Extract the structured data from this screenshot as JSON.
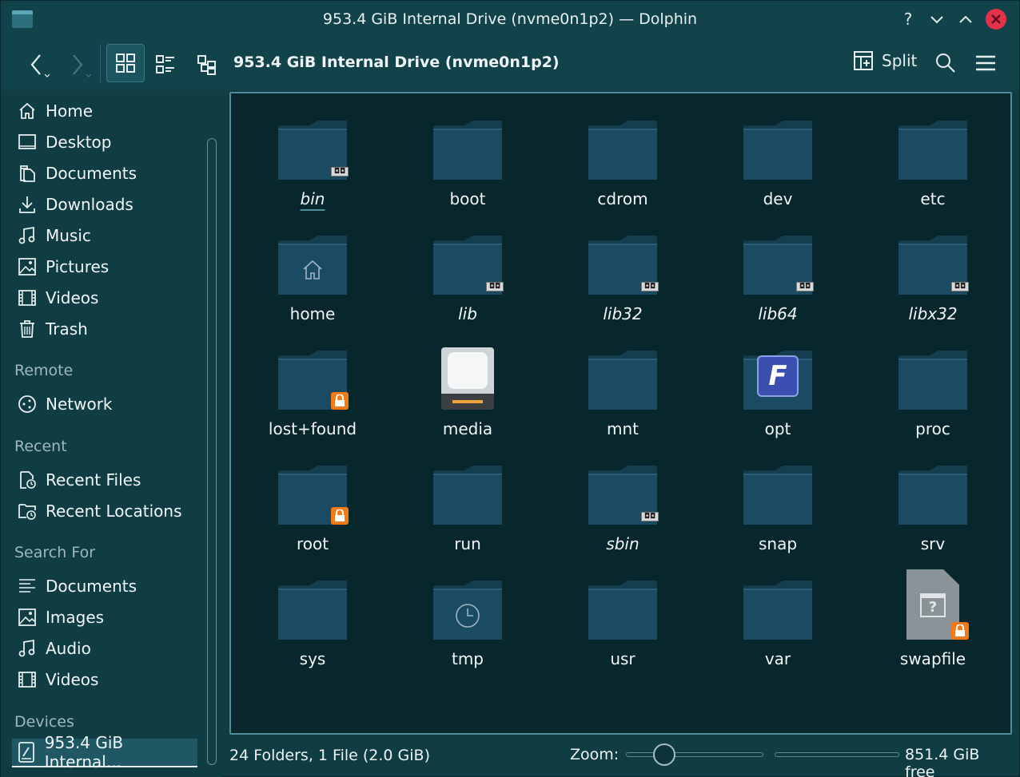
{
  "window": {
    "title": "953.4 GiB Internal Drive (nvme0n1p2) — Dolphin",
    "help": "?",
    "minimize": "⌄",
    "maximize": "⌃",
    "close": "✕"
  },
  "toolbar": {
    "back_icon": "chevron-left-icon",
    "forward_icon": "chevron-right-icon",
    "location": "953.4 GiB Internal Drive (nvme0n1p2)",
    "split_label": "Split"
  },
  "sidebar": {
    "places": [
      {
        "label": "Home",
        "icon": "home-icon"
      },
      {
        "label": "Desktop",
        "icon": "desktop-icon"
      },
      {
        "label": "Documents",
        "icon": "documents-icon"
      },
      {
        "label": "Downloads",
        "icon": "downloads-icon"
      },
      {
        "label": "Music",
        "icon": "music-icon"
      },
      {
        "label": "Pictures",
        "icon": "pictures-icon"
      },
      {
        "label": "Videos",
        "icon": "videos-icon"
      },
      {
        "label": "Trash",
        "icon": "trash-icon"
      }
    ],
    "remote_heading": "Remote",
    "remote": [
      {
        "label": "Network",
        "icon": "network-icon"
      }
    ],
    "recent_heading": "Recent",
    "recent": [
      {
        "label": "Recent Files",
        "icon": "recent-files-icon"
      },
      {
        "label": "Recent Locations",
        "icon": "recent-locations-icon"
      }
    ],
    "search_heading": "Search For",
    "search": [
      {
        "label": "Documents",
        "icon": "documents-search-icon"
      },
      {
        "label": "Images",
        "icon": "images-icon"
      },
      {
        "label": "Audio",
        "icon": "audio-icon"
      },
      {
        "label": "Videos",
        "icon": "videos-search-icon"
      }
    ],
    "devices_heading": "Devices",
    "devices": [
      {
        "label": "953.4 GiB Internal...",
        "icon": "drive-icon"
      }
    ]
  },
  "files": [
    {
      "name": "bin",
      "type": "folder",
      "badge": "link",
      "italic": true
    },
    {
      "name": "boot",
      "type": "folder"
    },
    {
      "name": "cdrom",
      "type": "folder"
    },
    {
      "name": "dev",
      "type": "folder"
    },
    {
      "name": "etc",
      "type": "folder"
    },
    {
      "name": "home",
      "type": "folder-home"
    },
    {
      "name": "lib",
      "type": "folder",
      "badge": "link",
      "italic": true
    },
    {
      "name": "lib32",
      "type": "folder",
      "badge": "link",
      "italic": true
    },
    {
      "name": "lib64",
      "type": "folder",
      "badge": "link",
      "italic": true
    },
    {
      "name": "libx32",
      "type": "folder",
      "badge": "link",
      "italic": true
    },
    {
      "name": "lost+found",
      "type": "folder",
      "badge": "lock"
    },
    {
      "name": "media",
      "type": "drive"
    },
    {
      "name": "mnt",
      "type": "folder"
    },
    {
      "name": "opt",
      "type": "folder-app"
    },
    {
      "name": "proc",
      "type": "folder"
    },
    {
      "name": "root",
      "type": "folder",
      "badge": "lock"
    },
    {
      "name": "run",
      "type": "folder"
    },
    {
      "name": "sbin",
      "type": "folder",
      "badge": "link",
      "italic": true
    },
    {
      "name": "snap",
      "type": "folder"
    },
    {
      "name": "srv",
      "type": "folder"
    },
    {
      "name": "sys",
      "type": "folder"
    },
    {
      "name": "tmp",
      "type": "folder-clock"
    },
    {
      "name": "usr",
      "type": "folder"
    },
    {
      "name": "var",
      "type": "folder"
    },
    {
      "name": "swapfile",
      "type": "file-unknown",
      "badge": "lock"
    }
  ],
  "status": {
    "summary": "24 Folders, 1 File (2.0 GiB)",
    "zoom_label": "Zoom:",
    "free": "851.4 GiB free"
  },
  "colors": {
    "accent": "#4f8d9a",
    "close": "#e5314b",
    "lock_badge": "#f47a18",
    "background": "#103d44",
    "view": "#07272c"
  }
}
